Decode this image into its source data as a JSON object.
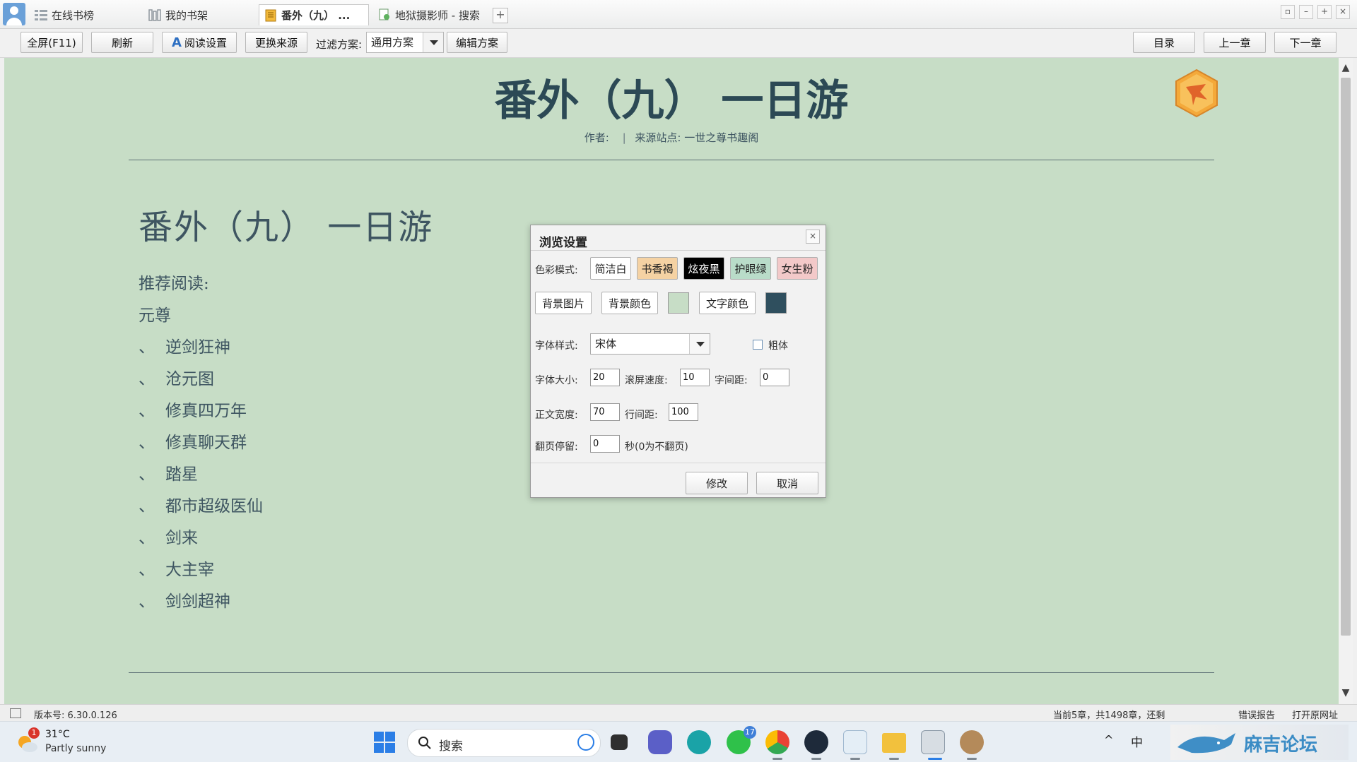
{
  "tabs": [
    {
      "label": "在线书榜"
    },
    {
      "label": "我的书架"
    },
    {
      "label": "番外（九） ..."
    },
    {
      "label": "地狱摄影师 - 搜索"
    }
  ],
  "new_tab_label": "+",
  "toolbar": {
    "fullscreen": "全屏(F11)",
    "refresh": "刷新",
    "reading_settings": "阅读设置",
    "change_source": "更换来源",
    "filter_label": "过滤方案:",
    "filter_value": "通用方案",
    "edit_scheme": "编辑方案",
    "toc": "目录",
    "prev_chapter": "上一章",
    "next_chapter": "下一章"
  },
  "chapter": {
    "header_title": "番外（九） 一日游",
    "author_label": "作者:",
    "separator": "|",
    "source_label": "来源站点:",
    "source_value": "一世之尊书趣阁",
    "content_title": "番外（九） 一日游",
    "recommend": "推荐阅读:",
    "first_item": "元尊",
    "items": [
      "逆剑狂神",
      "沧元图",
      "修真四万年",
      "修真聊天群",
      "踏星",
      "都市超级医仙",
      "剑来",
      "大主宰",
      "剑剑超神"
    ],
    "item_bullet": "、"
  },
  "dialog": {
    "title": "浏览设置",
    "close": "×",
    "color_mode_label": "色彩模式:",
    "modes": [
      "简洁白",
      "书香褐",
      "炫夜黑",
      "护眼绿",
      "女生粉"
    ],
    "bg_image": "背景图片",
    "bg_color": "背景颜色",
    "text_color": "文字颜色",
    "bg_swatch_color": "#c7ddc6",
    "text_swatch_color": "#2f4f5e",
    "font_style_label": "字体样式:",
    "font_value": "宋体",
    "bold_label": "粗体",
    "font_size_label": "字体大小:",
    "font_size": "20",
    "scroll_speed_label": "滚屏速度:",
    "scroll_speed": "10",
    "char_spacing_label": "字间距:",
    "char_spacing": "0",
    "body_width_label": "正文宽度:",
    "body_width": "70",
    "line_spacing_label": "行间距:",
    "line_spacing": "100",
    "page_stay_label": "翻页停留:",
    "page_stay": "0",
    "page_stay_suffix": "秒(0为不翻页)",
    "modify": "修改",
    "cancel": "取消"
  },
  "status": {
    "version": "版本号: 6.30.0.126",
    "chapter_info": "当前5章，共1498章，还剩",
    "error_report": "错误报告",
    "open_original": "打开原网址"
  },
  "taskbar": {
    "temperature": "31°C",
    "weather": "Partly sunny",
    "weather_badge": "1",
    "search": "搜索",
    "whatsapp_badge": "17",
    "ime_lang": "中",
    "watermark": "麻吉论坛"
  }
}
